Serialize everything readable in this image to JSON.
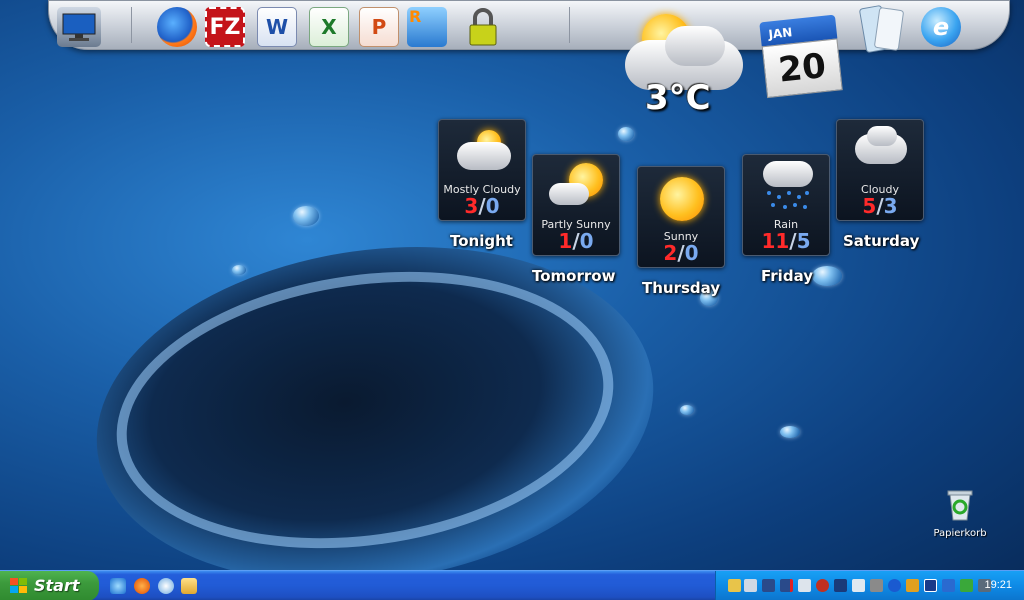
{
  "weather": {
    "current_temp": "3°C",
    "forecast": [
      {
        "day": "Tonight",
        "condition": "Mostly Cloudy",
        "high": "3",
        "low": "0",
        "icon": "mostly-cloudy-icon"
      },
      {
        "day": "Tomorrow",
        "condition": "Partly Sunny",
        "high": "1",
        "low": "0",
        "icon": "partly-sunny-icon"
      },
      {
        "day": "Thursday",
        "condition": "Sunny",
        "high": "2",
        "low": "0",
        "icon": "sunny-icon"
      },
      {
        "day": "Friday",
        "condition": "Rain",
        "high": "11",
        "low": "5",
        "icon": "rain-icon"
      },
      {
        "day": "Saturday",
        "condition": "Cloudy",
        "high": "5",
        "low": "3",
        "icon": "cloudy-icon"
      }
    ],
    "separator": "/"
  },
  "calendar": {
    "month": "JAN",
    "day": "20"
  },
  "dock": {
    "items": [
      "monitor-icon",
      "firefox-icon",
      "filezilla-icon",
      "word-icon",
      "excel-icon",
      "powerpoint-icon",
      "remote-desktop-icon",
      "lock-icon",
      "weather-icon",
      "calendar-icon",
      "documents-icon",
      "internet-explorer-icon"
    ],
    "filezilla_text": "FZ",
    "word_text": "W",
    "excel_text": "X",
    "powerpoint_text": "P",
    "remote_text": "R"
  },
  "desktop": {
    "recycle_bin_label": "Papierkorb"
  },
  "taskbar": {
    "start_label": "Start",
    "quick_launch": [
      "internet-explorer-icon",
      "firefox-icon",
      "media-player-icon",
      "folder-icon"
    ],
    "clock": "19:21"
  },
  "colors": {
    "high_temp": "#ff2a2a",
    "low_temp": "#7aaaf0",
    "taskbar": "#245edb",
    "start_green": "#3c9a3c"
  }
}
